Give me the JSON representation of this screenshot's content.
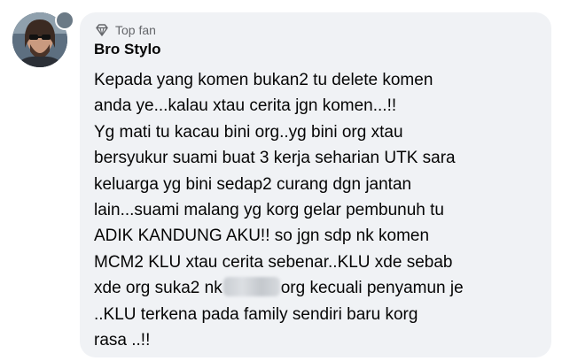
{
  "comment": {
    "badge": {
      "icon": "diamond-icon",
      "label": "Top fan"
    },
    "author": "Bro Stylo",
    "avatar": {
      "icon": "avatar-photo"
    },
    "lines": [
      "Kepada yang komen bukan2 tu delete komen",
      "anda ye...kalau xtau cerita jgn komen...!!",
      "Yg mati tu kacau bini org..yg bini org xtau",
      "bersyukur suami buat 3 kerja seharian UTK sara",
      "keluarga yg bini sedap2 curang dgn jantan",
      "lain...suami malang yg korg gelar pembunuh tu",
      "ADIK KANDUNG AKU!! so jgn sdp nk komen",
      "MCM2 KLU xtau cerita sebenar..KLU xde sebab"
    ],
    "line9": {
      "before": "xde org suka2 nk",
      "after": "org kecuali penyamun je"
    },
    "lines_end": [
      "..KLU terkena pada family sendiri baru korg",
      "rasa ..!!"
    ]
  },
  "colors": {
    "bubble": "#f0f2f5",
    "text": "#050505",
    "muted": "#65676b"
  }
}
